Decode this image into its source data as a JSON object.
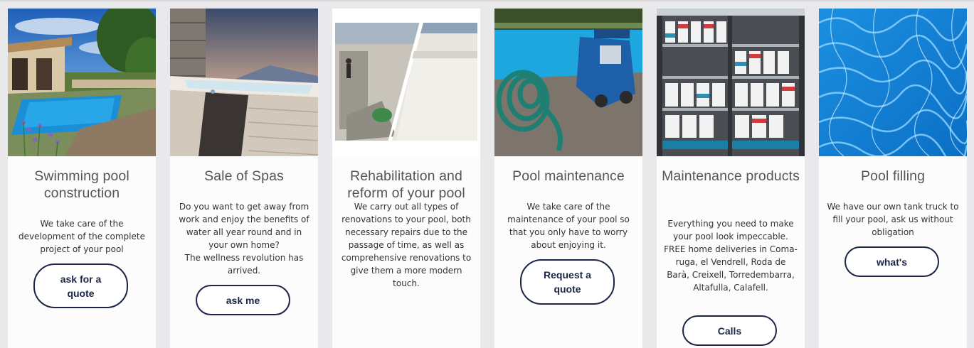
{
  "cards": [
    {
      "title": "Swimming pool construction",
      "description": "We take care of the development of the complete project of your pool",
      "button": "ask for a quote"
    },
    {
      "title": "Sale of Spas",
      "description": "Do you want to get away from work and enjoy the benefits of water all year round and in your own home?\nThe wellness revolution has arrived.",
      "button": "ask me"
    },
    {
      "title": "Rehabilitation and reform of your pool",
      "description": "We carry out all types of renovations to your pool, both necessary repairs due to the passage of time, as well as comprehensive renovations to give them a more modern touch."
    },
    {
      "title": "Pool maintenance",
      "description": "We take care of the maintenance of your pool so that you only have to worry about enjoying it.",
      "button": "Request a quote"
    },
    {
      "title": "Maintenance products",
      "description": "Everything you need to make your pool look impeccable. FREE home deliveries in Coma-ruga, el Vendrell, Roda de Barà, Creixell, Torredembarra, Altafulla, Calafell.",
      "button": "Calls"
    },
    {
      "title": "Pool filling",
      "description": "We have our own tank truck to fill your pool, ask us without obligation",
      "button": "what's"
    }
  ],
  "colors": {
    "button_border": "#1c2547",
    "title": "#555555",
    "card_bg": "#fcfcfc",
    "page_bg": "#e9e9eb"
  }
}
